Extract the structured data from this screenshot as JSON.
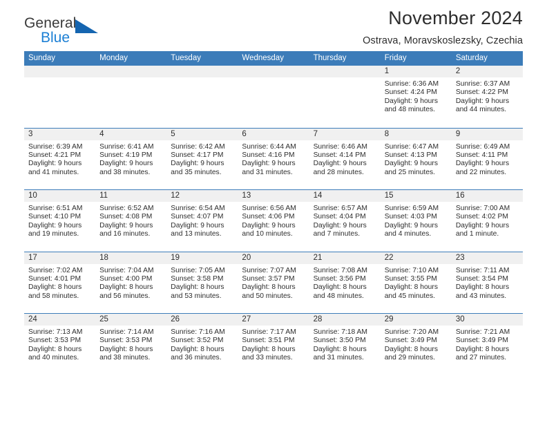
{
  "brand": {
    "name_top": "General",
    "name_bottom": "Blue",
    "triangle_color": "#1565b0",
    "blue_color": "#1b7fd4"
  },
  "header": {
    "title": "November 2024",
    "subtitle": "Ostrava, Moravskoslezsky, Czechia"
  },
  "theme": {
    "header_blue": "#3c7cb9",
    "day_band_gray": "#f0f0f0",
    "text": "#2d2d2d"
  },
  "weekdays": [
    "Sunday",
    "Monday",
    "Tuesday",
    "Wednesday",
    "Thursday",
    "Friday",
    "Saturday"
  ],
  "labels": {
    "sunrise_prefix": "Sunrise:",
    "sunset_prefix": "Sunset:",
    "daylight_prefix": "Daylight:"
  },
  "weeks": [
    [
      {
        "day": "",
        "empty": true
      },
      {
        "day": "",
        "empty": true
      },
      {
        "day": "",
        "empty": true
      },
      {
        "day": "",
        "empty": true
      },
      {
        "day": "",
        "empty": true
      },
      {
        "day": "1",
        "sunrise": "Sunrise: 6:36 AM",
        "sunset": "Sunset: 4:24 PM",
        "daylight_1": "Daylight: 9 hours",
        "daylight_2": "and 48 minutes."
      },
      {
        "day": "2",
        "sunrise": "Sunrise: 6:37 AM",
        "sunset": "Sunset: 4:22 PM",
        "daylight_1": "Daylight: 9 hours",
        "daylight_2": "and 44 minutes."
      }
    ],
    [
      {
        "day": "3",
        "sunrise": "Sunrise: 6:39 AM",
        "sunset": "Sunset: 4:21 PM",
        "daylight_1": "Daylight: 9 hours",
        "daylight_2": "and 41 minutes."
      },
      {
        "day": "4",
        "sunrise": "Sunrise: 6:41 AM",
        "sunset": "Sunset: 4:19 PM",
        "daylight_1": "Daylight: 9 hours",
        "daylight_2": "and 38 minutes."
      },
      {
        "day": "5",
        "sunrise": "Sunrise: 6:42 AM",
        "sunset": "Sunset: 4:17 PM",
        "daylight_1": "Daylight: 9 hours",
        "daylight_2": "and 35 minutes."
      },
      {
        "day": "6",
        "sunrise": "Sunrise: 6:44 AM",
        "sunset": "Sunset: 4:16 PM",
        "daylight_1": "Daylight: 9 hours",
        "daylight_2": "and 31 minutes."
      },
      {
        "day": "7",
        "sunrise": "Sunrise: 6:46 AM",
        "sunset": "Sunset: 4:14 PM",
        "daylight_1": "Daylight: 9 hours",
        "daylight_2": "and 28 minutes."
      },
      {
        "day": "8",
        "sunrise": "Sunrise: 6:47 AM",
        "sunset": "Sunset: 4:13 PM",
        "daylight_1": "Daylight: 9 hours",
        "daylight_2": "and 25 minutes."
      },
      {
        "day": "9",
        "sunrise": "Sunrise: 6:49 AM",
        "sunset": "Sunset: 4:11 PM",
        "daylight_1": "Daylight: 9 hours",
        "daylight_2": "and 22 minutes."
      }
    ],
    [
      {
        "day": "10",
        "sunrise": "Sunrise: 6:51 AM",
        "sunset": "Sunset: 4:10 PM",
        "daylight_1": "Daylight: 9 hours",
        "daylight_2": "and 19 minutes."
      },
      {
        "day": "11",
        "sunrise": "Sunrise: 6:52 AM",
        "sunset": "Sunset: 4:08 PM",
        "daylight_1": "Daylight: 9 hours",
        "daylight_2": "and 16 minutes."
      },
      {
        "day": "12",
        "sunrise": "Sunrise: 6:54 AM",
        "sunset": "Sunset: 4:07 PM",
        "daylight_1": "Daylight: 9 hours",
        "daylight_2": "and 13 minutes."
      },
      {
        "day": "13",
        "sunrise": "Sunrise: 6:56 AM",
        "sunset": "Sunset: 4:06 PM",
        "daylight_1": "Daylight: 9 hours",
        "daylight_2": "and 10 minutes."
      },
      {
        "day": "14",
        "sunrise": "Sunrise: 6:57 AM",
        "sunset": "Sunset: 4:04 PM",
        "daylight_1": "Daylight: 9 hours",
        "daylight_2": "and 7 minutes."
      },
      {
        "day": "15",
        "sunrise": "Sunrise: 6:59 AM",
        "sunset": "Sunset: 4:03 PM",
        "daylight_1": "Daylight: 9 hours",
        "daylight_2": "and 4 minutes."
      },
      {
        "day": "16",
        "sunrise": "Sunrise: 7:00 AM",
        "sunset": "Sunset: 4:02 PM",
        "daylight_1": "Daylight: 9 hours",
        "daylight_2": "and 1 minute."
      }
    ],
    [
      {
        "day": "17",
        "sunrise": "Sunrise: 7:02 AM",
        "sunset": "Sunset: 4:01 PM",
        "daylight_1": "Daylight: 8 hours",
        "daylight_2": "and 58 minutes."
      },
      {
        "day": "18",
        "sunrise": "Sunrise: 7:04 AM",
        "sunset": "Sunset: 4:00 PM",
        "daylight_1": "Daylight: 8 hours",
        "daylight_2": "and 56 minutes."
      },
      {
        "day": "19",
        "sunrise": "Sunrise: 7:05 AM",
        "sunset": "Sunset: 3:58 PM",
        "daylight_1": "Daylight: 8 hours",
        "daylight_2": "and 53 minutes."
      },
      {
        "day": "20",
        "sunrise": "Sunrise: 7:07 AM",
        "sunset": "Sunset: 3:57 PM",
        "daylight_1": "Daylight: 8 hours",
        "daylight_2": "and 50 minutes."
      },
      {
        "day": "21",
        "sunrise": "Sunrise: 7:08 AM",
        "sunset": "Sunset: 3:56 PM",
        "daylight_1": "Daylight: 8 hours",
        "daylight_2": "and 48 minutes."
      },
      {
        "day": "22",
        "sunrise": "Sunrise: 7:10 AM",
        "sunset": "Sunset: 3:55 PM",
        "daylight_1": "Daylight: 8 hours",
        "daylight_2": "and 45 minutes."
      },
      {
        "day": "23",
        "sunrise": "Sunrise: 7:11 AM",
        "sunset": "Sunset: 3:54 PM",
        "daylight_1": "Daylight: 8 hours",
        "daylight_2": "and 43 minutes."
      }
    ],
    [
      {
        "day": "24",
        "sunrise": "Sunrise: 7:13 AM",
        "sunset": "Sunset: 3:53 PM",
        "daylight_1": "Daylight: 8 hours",
        "daylight_2": "and 40 minutes."
      },
      {
        "day": "25",
        "sunrise": "Sunrise: 7:14 AM",
        "sunset": "Sunset: 3:53 PM",
        "daylight_1": "Daylight: 8 hours",
        "daylight_2": "and 38 minutes."
      },
      {
        "day": "26",
        "sunrise": "Sunrise: 7:16 AM",
        "sunset": "Sunset: 3:52 PM",
        "daylight_1": "Daylight: 8 hours",
        "daylight_2": "and 36 minutes."
      },
      {
        "day": "27",
        "sunrise": "Sunrise: 7:17 AM",
        "sunset": "Sunset: 3:51 PM",
        "daylight_1": "Daylight: 8 hours",
        "daylight_2": "and 33 minutes."
      },
      {
        "day": "28",
        "sunrise": "Sunrise: 7:18 AM",
        "sunset": "Sunset: 3:50 PM",
        "daylight_1": "Daylight: 8 hours",
        "daylight_2": "and 31 minutes."
      },
      {
        "day": "29",
        "sunrise": "Sunrise: 7:20 AM",
        "sunset": "Sunset: 3:49 PM",
        "daylight_1": "Daylight: 8 hours",
        "daylight_2": "and 29 minutes."
      },
      {
        "day": "30",
        "sunrise": "Sunrise: 7:21 AM",
        "sunset": "Sunset: 3:49 PM",
        "daylight_1": "Daylight: 8 hours",
        "daylight_2": "and 27 minutes."
      }
    ]
  ]
}
